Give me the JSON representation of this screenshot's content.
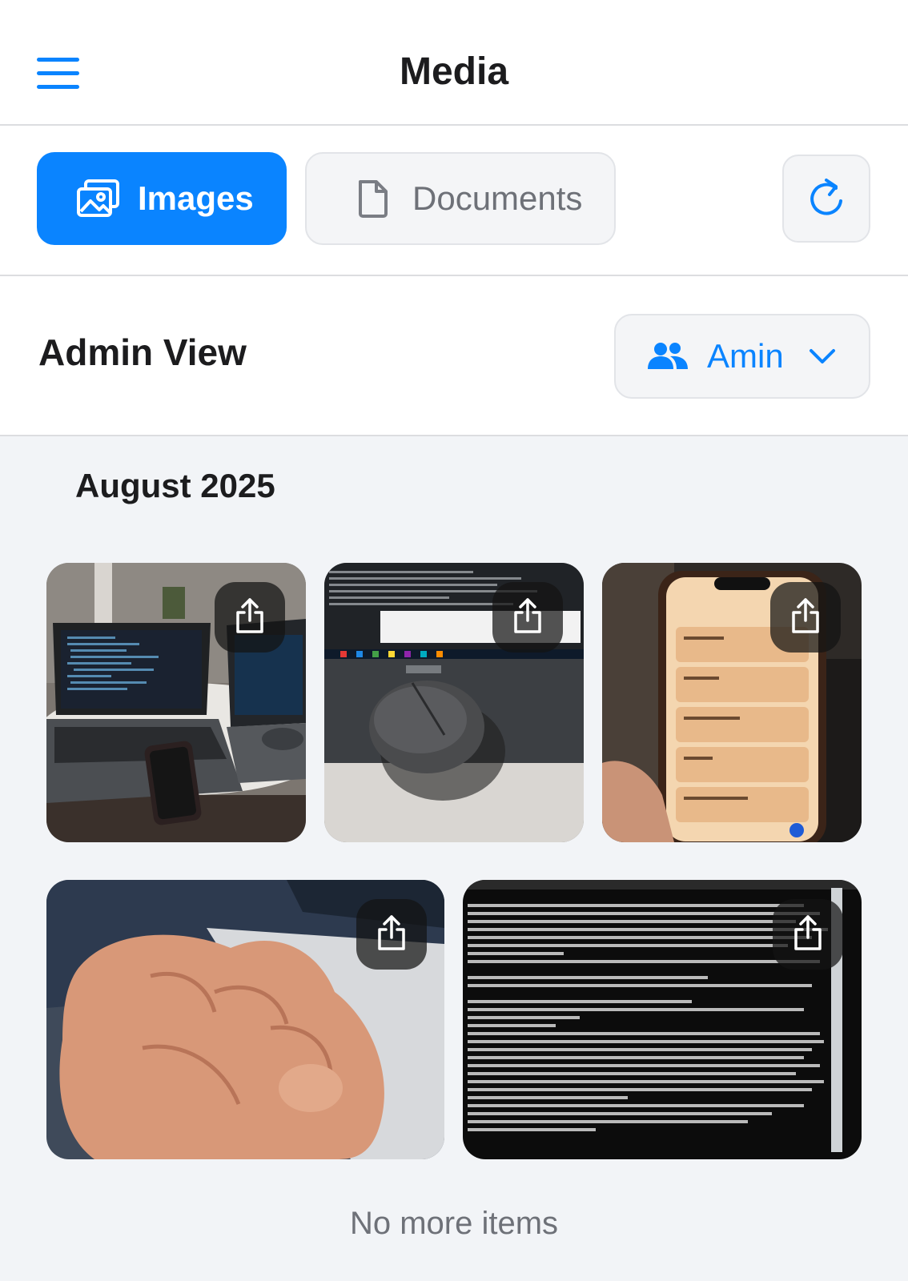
{
  "header": {
    "title": "Media",
    "menu_icon": "hamburger-icon"
  },
  "tabs": [
    {
      "label": "Images",
      "icon": "image-icon",
      "active": true
    },
    {
      "label": "Documents",
      "icon": "document-icon",
      "active": false
    }
  ],
  "refresh": {
    "icon": "refresh-icon"
  },
  "admin": {
    "title": "Admin View",
    "user_select": {
      "value": "Amin",
      "icon": "users-icon",
      "chevron": "chevron-down-icon"
    }
  },
  "gallery": {
    "month": "August 2025",
    "items": [
      {
        "subject": "laptops",
        "share_icon": "share-icon"
      },
      {
        "subject": "mouse",
        "share_icon": "share-icon"
      },
      {
        "subject": "phone",
        "share_icon": "share-icon"
      },
      {
        "subject": "fist",
        "share_icon": "share-icon"
      },
      {
        "subject": "terminal",
        "share_icon": "share-icon"
      }
    ],
    "end_text": "No more items"
  },
  "colors": {
    "accent": "#0a84ff",
    "background": "#f2f4f7",
    "surface": "#ffffff"
  }
}
